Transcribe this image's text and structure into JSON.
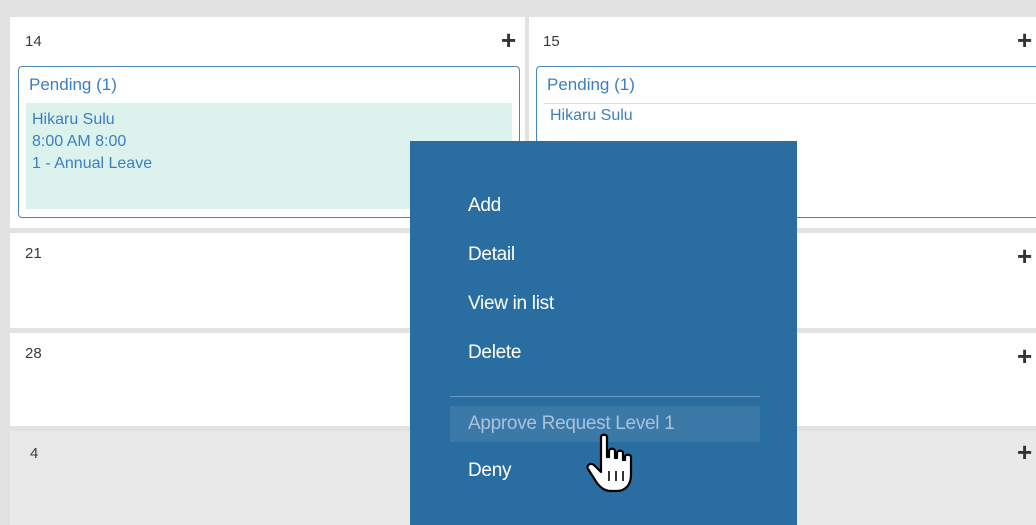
{
  "calendar": {
    "add_icon": "plus-icon",
    "rows": [
      {
        "days": [
          {
            "number": "14",
            "entry": {
              "header": "Pending (1)",
              "name": "Hikaru Sulu",
              "time": "8:00 AM 8:00",
              "leave": "1 - Annual Leave"
            }
          },
          {
            "number": "15",
            "entry": {
              "header": "Pending (1)",
              "name": "Hikaru Sulu"
            }
          }
        ]
      },
      {
        "days": [
          {
            "number": "21"
          }
        ]
      },
      {
        "days": [
          {
            "number": "28"
          }
        ]
      },
      {
        "days": [
          {
            "number": "4"
          }
        ]
      }
    ]
  },
  "context_menu": {
    "items": [
      "Add",
      "Detail",
      "View in list",
      "Delete"
    ],
    "disabled_item": "Approve Request Level 1",
    "last_item": "Deny"
  },
  "colors": {
    "menu_bg": "#2a6ea1",
    "pending_text": "#3c7fc0",
    "entry_bg": "#dcf2ec"
  }
}
